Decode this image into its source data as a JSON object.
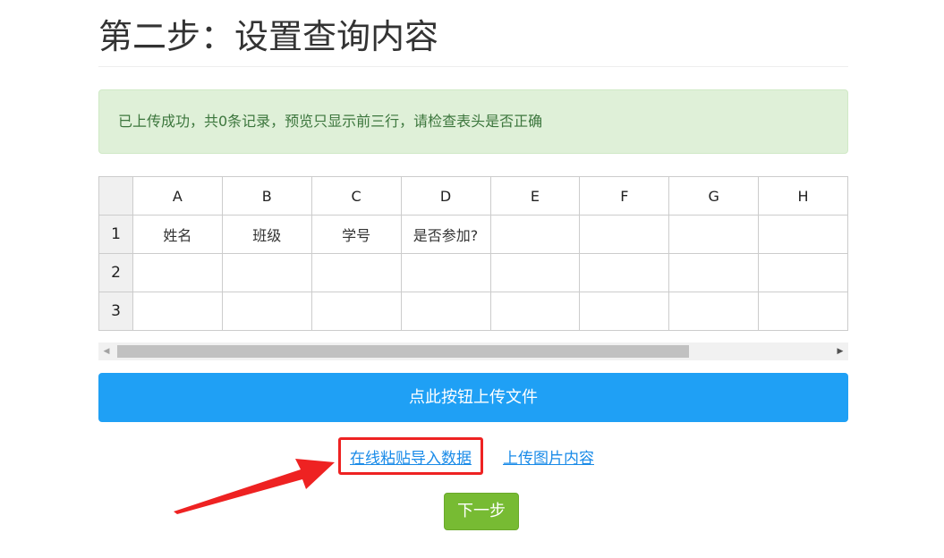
{
  "page": {
    "title": "第二步：设置查询内容"
  },
  "alert": {
    "message": "已上传成功，共0条记录，预览只显示前三行，请检查表头是否正确"
  },
  "grid": {
    "columns": [
      "A",
      "B",
      "C",
      "D",
      "E",
      "F",
      "G",
      "H"
    ],
    "rows": [
      {
        "num": "1",
        "cells": [
          "姓名",
          "班级",
          "学号",
          "是否参加?",
          "",
          "",
          "",
          ""
        ]
      },
      {
        "num": "2",
        "cells": [
          "",
          "",
          "",
          "",
          "",
          "",
          "",
          ""
        ]
      },
      {
        "num": "3",
        "cells": [
          "",
          "",
          "",
          "",
          "",
          "",
          "",
          ""
        ]
      }
    ]
  },
  "upload_button": {
    "label": "点此按钮上传文件"
  },
  "links": {
    "paste_import": "在线粘贴导入数据",
    "upload_image": "上传图片内容"
  },
  "next_button": {
    "label": "下一步"
  },
  "colors": {
    "primary": "#1fa0f5",
    "success_bg": "#dff0d8",
    "success_text": "#3c763d",
    "link": "#1a8be8",
    "next": "#77bb33",
    "annotation": "#ee2222"
  }
}
